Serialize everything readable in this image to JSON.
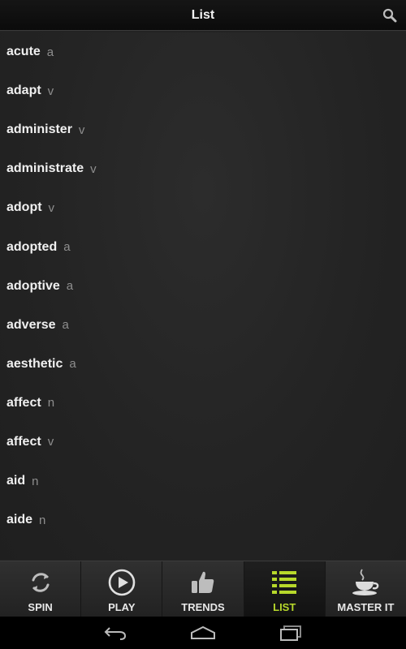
{
  "header": {
    "title": "List",
    "search_icon": "search-icon"
  },
  "words": [
    {
      "term": "acute",
      "pos": "a"
    },
    {
      "term": "adapt",
      "pos": "v"
    },
    {
      "term": "administer",
      "pos": "v"
    },
    {
      "term": "administrate",
      "pos": "v"
    },
    {
      "term": "adopt",
      "pos": "v"
    },
    {
      "term": "adopted",
      "pos": "a"
    },
    {
      "term": "adoptive",
      "pos": "a"
    },
    {
      "term": "adverse",
      "pos": "a"
    },
    {
      "term": "aesthetic",
      "pos": "a"
    },
    {
      "term": "affect",
      "pos": "n"
    },
    {
      "term": "affect",
      "pos": "v"
    },
    {
      "term": "aid",
      "pos": "n"
    },
    {
      "term": "aide",
      "pos": "n"
    }
  ],
  "tabs": [
    {
      "label": "SPIN",
      "icon": "spin-icon",
      "active": false
    },
    {
      "label": "PLAY",
      "icon": "play-icon",
      "active": false
    },
    {
      "label": "TRENDS",
      "icon": "thumbs-up-icon",
      "active": false
    },
    {
      "label": "LIST",
      "icon": "list-icon",
      "active": true
    },
    {
      "label": "MASTER IT",
      "icon": "coffee-cup-icon",
      "active": false
    }
  ],
  "system_nav": [
    "back-icon",
    "home-icon",
    "recents-icon"
  ],
  "colors": {
    "accent": "#b7d82b",
    "background": "#232323",
    "text": "#f0f0f0",
    "secondary_text": "#8e8e8e"
  }
}
